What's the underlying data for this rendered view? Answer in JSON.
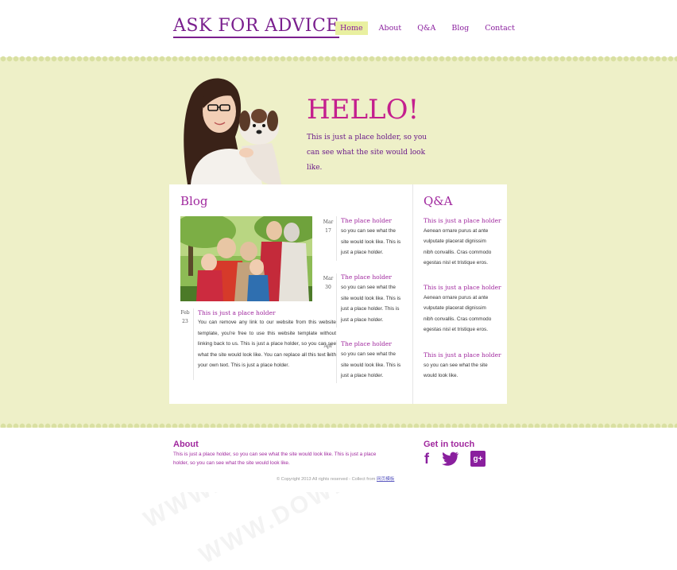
{
  "site": {
    "logo": "ASK FOR ADVICE"
  },
  "nav": [
    {
      "label": "Home",
      "active": true
    },
    {
      "label": "About"
    },
    {
      "label": "Q&A"
    },
    {
      "label": "Blog"
    },
    {
      "label": "Contact"
    }
  ],
  "hero": {
    "title": "HELLO!",
    "text": "This is just a place holder, so you can see what the site would look like."
  },
  "blog": {
    "heading": "Blog",
    "feature": {
      "date_month": "Feb",
      "date_day": "23",
      "title": "This is just a place holder",
      "body": "You can remove any link to our website from this website template, you're free to use this website template without linking back to us. This is just a place holder, so you can see what the site would look like. You can replace all this text with your own text. This is just a place holder."
    },
    "posts": [
      {
        "date_month": "Mar",
        "date_day": "17",
        "title": "The place holder",
        "body": "so you can see what the site would look like. This is just a place holder."
      },
      {
        "date_month": "Mar",
        "date_day": "30",
        "title": "The place holder",
        "body": "so you can see what the site would look like. This is just a place holder. This is just a place holder."
      },
      {
        "date_month": "Apr",
        "date_day": "1",
        "title": "The place holder",
        "body": "so you can see what the site would look like. This is just a place holder."
      }
    ]
  },
  "qa": {
    "heading": "Q&A",
    "items": [
      {
        "title": "This is just a place holder",
        "body": "Aenean ornare purus at ante vulputate placerat dignissim nibh convallis. Cras commodo egestas nisl et tristique eros."
      },
      {
        "title": "This is just a place holder",
        "body": "Aenean ornare purus at ante vulputate placerat dignissim nibh convallis. Cras commodo egestas nisl et tristique eros."
      },
      {
        "title": "This is just a place holder",
        "body": "so you can see what the site would look like."
      }
    ]
  },
  "footer": {
    "about_heading": "About",
    "about_text": "This is just a place holder, so you can see what the site would look like. This is just a place holder, so you can see what the site would look like.",
    "touch_heading": "Get in touch",
    "social": [
      {
        "icon": "facebook-icon",
        "glyph": "f"
      },
      {
        "icon": "twitter-icon",
        "glyph": "🐦"
      },
      {
        "icon": "google-plus-icon",
        "glyph": "g+"
      }
    ],
    "copyright": "© Copyright 2013 All rights reserved - Collect from",
    "copyright_link": "网页模板"
  },
  "watermark": "WWW.DOWNDEMO.COM",
  "colors": {
    "accent": "#a0289e",
    "band": "#eef0c8",
    "nav_active": "#e9f0a0"
  }
}
